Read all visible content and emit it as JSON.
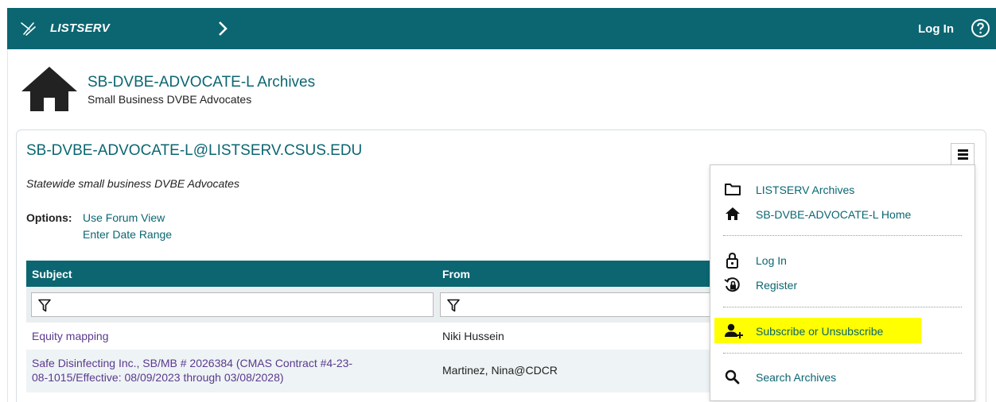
{
  "topbar": {
    "brand": "LISTSERV",
    "login": "Log In",
    "color": "#0b6671"
  },
  "header": {
    "list_title": "SB-DVBE-ADVOCATE-L Archives",
    "list_subtitle": "Small Business DVBE Advocates"
  },
  "card": {
    "title": "SB-DVBE-ADVOCATE-L@LISTSERV.CSUS.EDU",
    "description": "Statewide small business DVBE Advocates",
    "options_label": "Options:",
    "options": [
      "Use Forum View",
      "Enter Date Range"
    ]
  },
  "table": {
    "columns": [
      "Subject",
      "From"
    ],
    "rows": [
      {
        "subject": "Equity mapping",
        "from": "Niki Hussein"
      },
      {
        "subject_line1": "Safe Disinfecting Inc., SB/MB # 2026384 (CMAS Contract #4-23-",
        "subject_line2": "08-1015/Effective: 08/09/2023 through 03/08/2028)",
        "from": "Martinez, Nina@CDCR"
      }
    ]
  },
  "menu": {
    "items": [
      {
        "label": "LISTSERV Archives",
        "icon": "folder-icon"
      },
      {
        "label": "SB-DVBE-ADVOCATE-L Home",
        "icon": "home-icon"
      },
      {
        "label": "Log In",
        "icon": "lock-icon"
      },
      {
        "label": "Register",
        "icon": "register-icon"
      },
      {
        "label": "Subscribe or Unsubscribe",
        "icon": "add-user-icon",
        "highlight": "#ffff00"
      },
      {
        "label": "Search Archives",
        "icon": "search-icon"
      }
    ]
  }
}
